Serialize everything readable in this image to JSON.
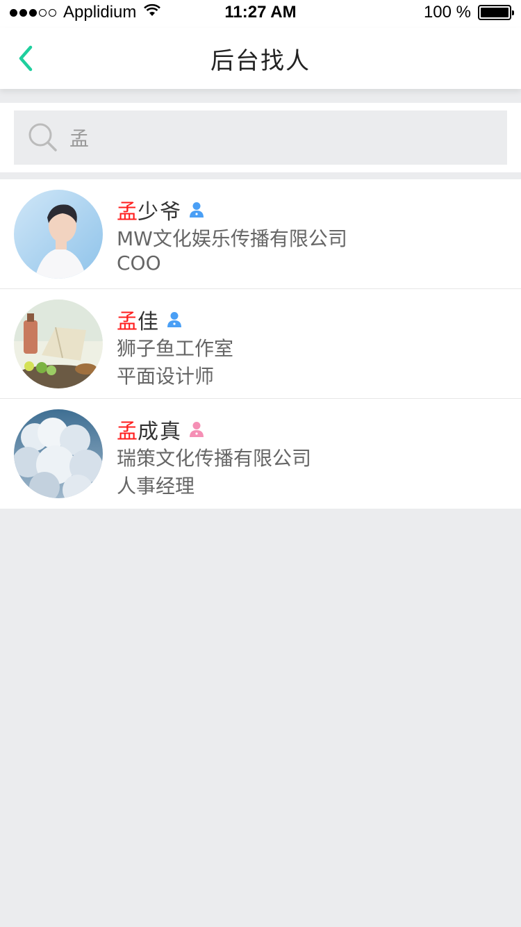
{
  "status_bar": {
    "carrier": "Applidium",
    "time": "11:27 AM",
    "battery": "100 %"
  },
  "nav": {
    "title": "后台找人",
    "back_icon": "chevron-left-icon"
  },
  "search": {
    "value": "孟",
    "icon": "search-icon"
  },
  "colors": {
    "accent": "#1fcf9e",
    "highlight": "#ff1e1e",
    "name": "#333333",
    "sub": "#666666",
    "male_icon": "#4a9ff5",
    "female_icon": "#f58fb5"
  },
  "results": [
    {
      "name_highlight": "孟",
      "name_rest": "少爷",
      "gender": "male",
      "company": "MW文化娱乐传播有限公司",
      "title": "COO"
    },
    {
      "name_highlight": "孟",
      "name_rest": "佳",
      "gender": "male",
      "company": "狮子鱼工作室",
      "title": "平面设计师"
    },
    {
      "name_highlight": "孟",
      "name_rest": "成真",
      "gender": "female",
      "company": "瑞策文化传播有限公司",
      "title": "人事经理"
    }
  ]
}
